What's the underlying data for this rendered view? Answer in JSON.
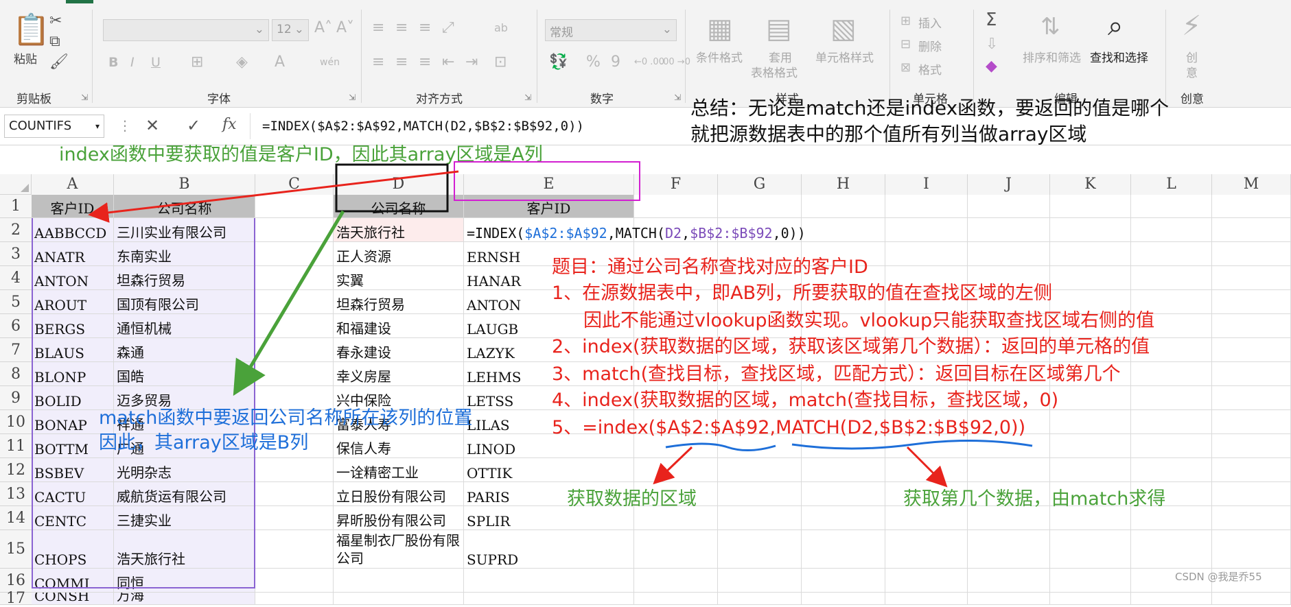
{
  "ribbon": {
    "clipboard": {
      "paste": "粘贴",
      "group": "剪贴板"
    },
    "font": {
      "name": "",
      "size": "12",
      "bold": "B",
      "italic": "I",
      "underline": "U",
      "phonetic": "wén",
      "group": "字体"
    },
    "alignment": {
      "wrap": "ab",
      "group": "对齐方式"
    },
    "number": {
      "format": "常规",
      "percent": "%",
      "comma": "9",
      "inc": "←0 .00",
      "dec": ".00 →0",
      "group": "数字"
    },
    "styles": {
      "conditional": "条件格式",
      "table_line1": "套用",
      "table_line2": "表格格式",
      "cell_styles": "单元格样式",
      "group": "样式"
    },
    "cells": {
      "insert": "插入",
      "delete": "删除",
      "format": "格式",
      "group": "单元格"
    },
    "editing": {
      "sum": "Σ",
      "sort": "排序和筛选",
      "find": "查找和选择",
      "group": "编辑"
    },
    "creative": {
      "line1": "创",
      "line2": "意",
      "group": "创意"
    }
  },
  "formula_bar": {
    "name_box": "COUNTIFS",
    "cancel": "✕",
    "enter": "✓",
    "fx": "fx",
    "formula": "=INDEX($A$2:$A$92,MATCH(D2,$B$2:$B$92,0))"
  },
  "columns": [
    "A",
    "B",
    "C",
    "D",
    "E",
    "F",
    "G",
    "H",
    "I",
    "J",
    "K",
    "L",
    "M"
  ],
  "rows": [
    {
      "n": "1",
      "A": "客户ID",
      "B": "公司名称",
      "D": "公司名称",
      "E": "客户ID"
    },
    {
      "n": "2",
      "A": "AABBCCD",
      "B": "三川实业有限公司",
      "D": "浩天旅行社",
      "E": ""
    },
    {
      "n": "3",
      "A": "ANATR",
      "B": "东南实业",
      "D": "正人资源",
      "E": "ERNSH"
    },
    {
      "n": "4",
      "A": "ANTON",
      "B": "坦森行贸易",
      "D": "实翼",
      "E": "HANAR"
    },
    {
      "n": "5",
      "A": "AROUT",
      "B": "国顶有限公司",
      "D": "坦森行贸易",
      "E": "ANTON"
    },
    {
      "n": "6",
      "A": "BERGS",
      "B": "通恒机械",
      "D": "和福建设",
      "E": "LAUGB"
    },
    {
      "n": "7",
      "A": "BLAUS",
      "B": "森通",
      "D": "春永建设",
      "E": "LAZYK"
    },
    {
      "n": "8",
      "A": "BLONP",
      "B": "国皓",
      "D": "幸义房屋",
      "E": "LEHMS"
    },
    {
      "n": "9",
      "A": "BOLID",
      "B": "迈多贸易",
      "D": "兴中保险",
      "E": "LETSS"
    },
    {
      "n": "10",
      "A": "BONAP",
      "B": "祥通",
      "D": "富泰人寿",
      "E": "LILAS"
    },
    {
      "n": "11",
      "A": "BOTTM",
      "B": "广通",
      "D": "保信人寿",
      "E": "LINOD"
    },
    {
      "n": "12",
      "A": "BSBEV",
      "B": "光明杂志",
      "D": "一诠精密工业",
      "E": "OTTIK"
    },
    {
      "n": "13",
      "A": "CACTU",
      "B": "威航货运有限公司",
      "D": "立日股份有限公司",
      "E": "PARIS"
    },
    {
      "n": "14",
      "A": "CENTC",
      "B": "三捷实业",
      "D": "昇昕股份有限公司",
      "E": "SPLIR"
    },
    {
      "n": "15",
      "A": "CHOPS",
      "B": "浩天旅行社",
      "D": "福星制衣厂股份有限公司",
      "E": "SUPRD"
    },
    {
      "n": "16",
      "A": "COMMI",
      "B": "同恒",
      "D": "",
      "E": ""
    },
    {
      "n": "17",
      "A": "CONSH",
      "B": "万海",
      "D": "",
      "E": ""
    }
  ],
  "edit_formula": {
    "p1": "=INDEX(",
    "p2": "$A$2:$A$92",
    "p3": ",MATCH(",
    "p4": "D2",
    "p5": ",",
    "p6": "$B$2:$B$92",
    "p7": ",0))"
  },
  "annotations": {
    "summary_1": "总结：无论是match还是index函数，要返回的值是哪个",
    "summary_2": "就把源数据表中的那个值所有列当做array区域",
    "index_note": "index函数中要获取的值是客户ID，因此其array区域是A列",
    "match_note_1": "match函数中要返回公司名称所在该列的位置",
    "match_note_2": "因此，其array区域是B列",
    "title": "题目：通过公司名称查找对应的客户ID",
    "step1": "1、在源数据表中，即AB列，所要获取的值在查找区域的左侧",
    "step1b": "因此不能通过vlookup函数实现。vlookup只能获取查找区域右侧的值",
    "step2": "2、index(获取数据的区域，获取该区域第几个数据）：返回的单元格的值",
    "step3": "3、match(查找目标，查找区域，匹配方式）：返回目标在区域第几个",
    "step4": "4、index(获取数据的区域，match(查找目标，查找区域，0)",
    "step5": "5、=index($A$2:$A$92,MATCH(D2,$B$2:$B$92,0))",
    "label_area": "获取数据的区域",
    "label_nth": "获取第几个数据，由match求得",
    "watermark": "CSDN @我是乔55"
  },
  "colors": {
    "red": "#e8231c",
    "green": "#4aa23a",
    "blue": "#1e6fd9",
    "header_gray": "#bfbfbf",
    "lavender": "#f1eefb"
  }
}
